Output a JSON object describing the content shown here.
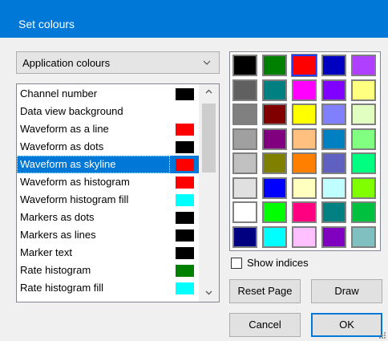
{
  "window": {
    "title": "Set colours"
  },
  "dropdown": {
    "value": "Application colours"
  },
  "list": {
    "items": [
      {
        "label": "Channel number",
        "swatch": "#000000"
      },
      {
        "label": "Data view background",
        "swatch": ""
      },
      {
        "label": "Waveform as a line",
        "swatch": "#ff0000"
      },
      {
        "label": "Waveform as dots",
        "swatch": "#000000"
      },
      {
        "label": "Waveform as skyline",
        "swatch": "#ff0000",
        "selected": true
      },
      {
        "label": "Waveform as histogram",
        "swatch": "#ff0000"
      },
      {
        "label": "Waveform histogram fill",
        "swatch": "#00ffff"
      },
      {
        "label": "Markers as dots",
        "swatch": "#000000"
      },
      {
        "label": "Markers as lines",
        "swatch": "#000000"
      },
      {
        "label": "Marker text",
        "swatch": "#000000"
      },
      {
        "label": "Rate histogram",
        "swatch": "#008000"
      },
      {
        "label": "Rate histogram fill",
        "swatch": "#00ffff"
      }
    ]
  },
  "palette": {
    "rows": [
      [
        "#000000",
        "#008000",
        "#ff0000",
        "#0000c0",
        "#b040ff"
      ],
      [
        "#606060",
        "#008080",
        "#ff00ff",
        "#8000ff",
        "#ffff80"
      ],
      [
        "#808080",
        "#800000",
        "#ffff00",
        "#8080ff",
        "#e0ffc0"
      ],
      [
        "#a0a0a0",
        "#800080",
        "#ffc080",
        "#0080c0",
        "#80ff80"
      ],
      [
        "#c0c0c0",
        "#808000",
        "#ff8000",
        "#6060c0",
        "#00ff80"
      ],
      [
        "#e0e0e0",
        "#0000ff",
        "#ffffc0",
        "#c0ffff",
        "#80ff00"
      ],
      [
        "#ffffff",
        "#00ff00",
        "#ff0080",
        "#008080",
        "#00c040"
      ],
      [
        "#000080",
        "#00ffff",
        "#ffc0ff",
        "#8000c0",
        "#80c0c0"
      ]
    ],
    "selected": {
      "row": 0,
      "col": 2
    }
  },
  "show_indices": {
    "label": "Show indices",
    "checked": false
  },
  "buttons": {
    "reset_page": "Reset Page",
    "draw": "Draw",
    "cancel": "Cancel",
    "ok": "OK"
  },
  "icons": {
    "dropdown": "chevron-down-icon",
    "scroll_up": "chevron-up-icon",
    "scroll_down": "chevron-down-icon",
    "resize": "resize-grip-icon"
  },
  "colors": {
    "accent": "#0078d7"
  }
}
